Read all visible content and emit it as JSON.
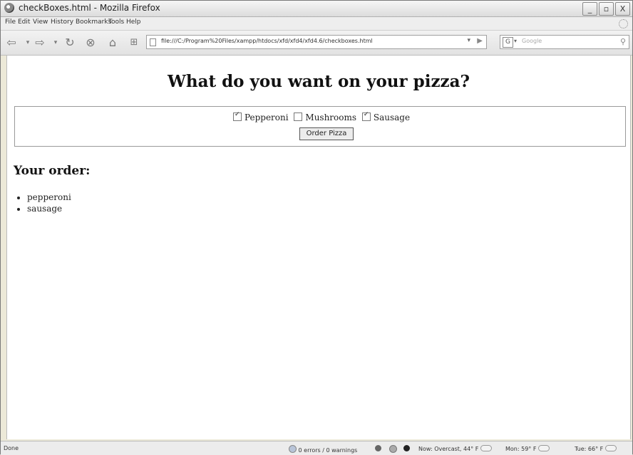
{
  "window": {
    "title": "checkBoxes.html - Mozilla Firefox",
    "controls": [
      "_",
      "▫",
      "X"
    ]
  },
  "menu": [
    "File",
    "Edit",
    "View",
    "History",
    "Bookmarks",
    "Tools",
    "Help"
  ],
  "nav": {
    "url": "file:///C:/Program%20Files/xampp/htdocs/xfd/xfd4/xfd4.6/checkboxes.html",
    "search_placeholder": "Google",
    "search_engine_letter": "G"
  },
  "page": {
    "heading": "What do you want on your pizza?",
    "toppings": [
      {
        "label": "Pepperoni",
        "checked": true
      },
      {
        "label": "Mushrooms",
        "checked": false
      },
      {
        "label": "Sausage",
        "checked": true
      }
    ],
    "order_button": "Order Pizza",
    "order_heading": "Your order:",
    "order_items": [
      "pepperoni",
      "sausage"
    ]
  },
  "status": {
    "done": "Done",
    "errors": "0 errors / 0 warnings",
    "weather_now": "Now: Overcast, 44° F",
    "weather_mon": "Mon: 59° F",
    "weather_tue": "Tue: 66° F"
  }
}
